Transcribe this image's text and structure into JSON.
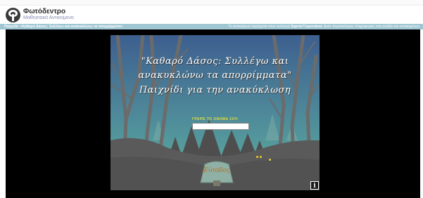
{
  "header": {
    "title": "Φωτόδεντρο",
    "subtitle": "Μαθησιακά Αντικείμενα"
  },
  "breadcrumb": {
    "left": "Παιχνίδι: «Καθαρό Δάσος: Συλλέγω και ανακυκλώνω τα απορρίμματα»",
    "right_prefix": "Το αντικείμενο περιέχεται στην συλλογή",
    "right_bold": "Χαρτιά Γιορτινάκια",
    "right_suffix": ". Δείτε περισσότερες πληροφορίες στη σελίδα του αντικειμένου."
  },
  "game": {
    "title_line1": "\"Καθαρό Δάσος: Συλλέγω και",
    "title_line2": "ανακυκλώνω τα απορρίμματα\"",
    "title_line3": "Παιχνίδι για την ανακύκλωση",
    "name_label": "ΓΡΑΨΕ ΤΟ ΟΝΟΜΑ ΣΟΥ:",
    "name_value": "",
    "enter_label": "Είσοδος",
    "info_label": "i"
  },
  "colors": {
    "breadcrumb_bg": "#9ec6d3",
    "sky_top": "#3d5f8f",
    "sky_bottom": "#5aaea0",
    "ground": "#5a5a5a",
    "label_yellow": "#e0e040",
    "enter_orange": "#c26b1a"
  },
  "icons": {
    "logo": "tree-logo-icon",
    "info": "info-icon"
  }
}
